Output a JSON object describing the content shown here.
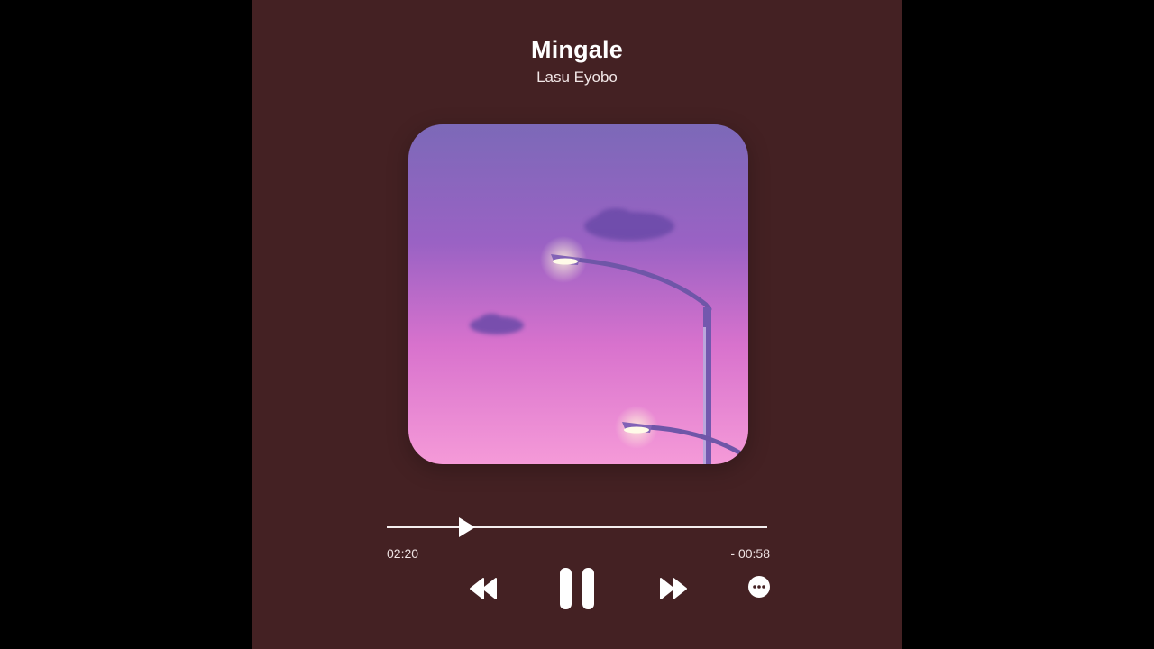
{
  "track": {
    "title": "Mingale",
    "artist": "Lasu Eyobo"
  },
  "artwork": {
    "description_icon": "album-art-streetlights-image"
  },
  "playback": {
    "elapsed": "02:20",
    "remaining": "- 00:58",
    "progress_fraction": 0.21,
    "state": "playing"
  },
  "controls": {
    "previous_icon": "rewind-icon",
    "pause_icon": "pause-icon",
    "next_icon": "fast-forward-icon",
    "more_icon": "more-options-icon"
  },
  "colors": {
    "background": "#442123",
    "outer": "#000000",
    "foreground": "#ffffff"
  }
}
